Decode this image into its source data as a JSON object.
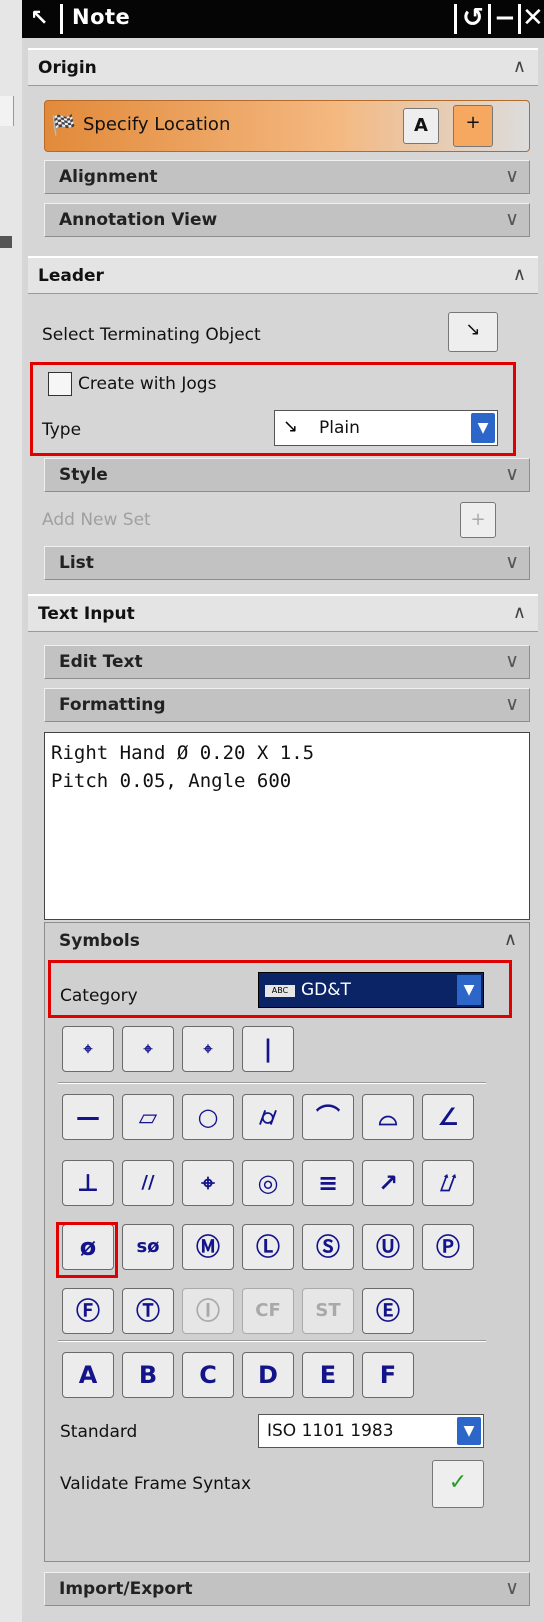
{
  "window": {
    "title": "Note",
    "reset_icon": "↺",
    "minimize_icon": "−",
    "close_icon": "✕"
  },
  "origin": {
    "header": "Origin",
    "collapse": "∧",
    "specify_location": "Specify Location",
    "alignment": "Alignment",
    "annotation_view": "Annotation View"
  },
  "leader": {
    "header": "Leader",
    "collapse": "∧",
    "select_terminating": "Select Terminating Object",
    "create_with_jogs": "Create with Jogs",
    "type_label": "Type",
    "type_value": "Plain",
    "style": "Style",
    "add_new_set": "Add New Set",
    "list": "List"
  },
  "text_input": {
    "header": "Text Input",
    "collapse": "∧",
    "edit_text": "Edit Text",
    "formatting": "Formatting",
    "text_line1": "Right Hand Ø 0.20 X 1.5",
    "text_line2": "Pitch 0.05, Angle 600"
  },
  "symbols": {
    "header": "Symbols",
    "collapse": "∧",
    "category_label": "Category",
    "category_value": "GD&T",
    "standard_label": "Standard",
    "standard_value": "ISO 1101 1983",
    "validate_label": "Validate Frame Syntax",
    "row2": [
      "—",
      "▱",
      "○",
      "⌭",
      "⌒",
      "⌓",
      "∠"
    ],
    "row3": [
      "⊥",
      "//",
      "⌖",
      "◎",
      "≡",
      "↗",
      "⌰"
    ],
    "row4": [
      "ø",
      "sø",
      "Ⓜ",
      "Ⓛ",
      "Ⓢ",
      "Ⓤ",
      "Ⓟ"
    ],
    "row5": [
      "Ⓕ",
      "Ⓣ",
      "Ⓘ",
      "CF",
      "ST",
      "Ⓔ"
    ],
    "row6": [
      "A",
      "B",
      "C",
      "D",
      "E",
      "F"
    ]
  },
  "import_export": {
    "header": "Import/Export",
    "expand": "∨"
  },
  "chevron": "∨"
}
